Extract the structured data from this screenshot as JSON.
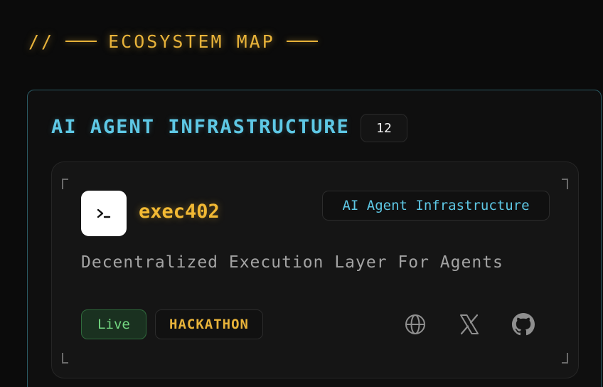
{
  "section": {
    "prefix": "//",
    "title": "ECOSYSTEM MAP"
  },
  "category": {
    "title": "AI AGENT INFRASTRUCTURE",
    "count": "12"
  },
  "project": {
    "logo_icon": "terminal-prompt-icon",
    "logo_glyph": ">_",
    "name": "exec402",
    "category_tag": "AI Agent Infrastructure",
    "description": "Decentralized Execution Layer For Agents",
    "status": "Live",
    "source": "HACKATHON",
    "links": [
      {
        "icon": "globe-icon"
      },
      {
        "icon": "x-icon"
      },
      {
        "icon": "github-icon"
      }
    ]
  },
  "colors": {
    "accent_gold": "#e8b33a",
    "accent_cyan": "#5ec8e5",
    "status_green": "#74d882",
    "panel_border": "#2b5a63",
    "background": "#0b0b0b"
  }
}
